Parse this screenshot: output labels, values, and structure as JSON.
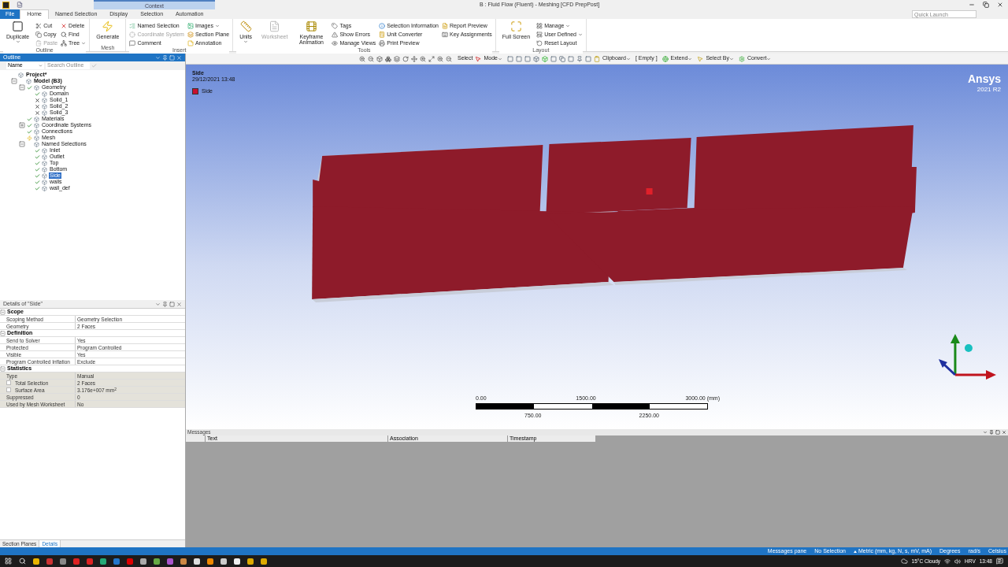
{
  "title_bar": {
    "context_label": "Context",
    "title": "B : Fluid Flow (Fluent) - Meshing [CFD PrepPost]",
    "quick_launch": {
      "placeholder": "Quick Launch"
    }
  },
  "ribbon_tabs": [
    {
      "label": "File",
      "kind": "file",
      "selected": false
    },
    {
      "label": "Home",
      "kind": "tab",
      "selected": true
    },
    {
      "label": "Named Selection",
      "kind": "tab",
      "selected": false
    },
    {
      "label": "Display",
      "kind": "tab",
      "selected": false
    },
    {
      "label": "Selection",
      "kind": "tab",
      "selected": false
    },
    {
      "label": "Automation",
      "kind": "tab",
      "selected": false
    }
  ],
  "ribbon_groups": [
    {
      "label": "Outline",
      "columns": [
        {
          "kind": "large",
          "label": "Duplicate",
          "disabled": false,
          "dropdown": true
        },
        {
          "kind": "stack",
          "items": [
            {
              "label": "Cut",
              "disabled": false,
              "dropdown": false
            },
            {
              "label": "Copy",
              "disabled": false,
              "dropdown": false
            },
            {
              "label": "Paste",
              "disabled": true,
              "dropdown": false
            }
          ]
        },
        {
          "kind": "stack",
          "items": [
            {
              "label": "Delete",
              "disabled": false,
              "dropdown": false
            },
            {
              "label": "Find",
              "disabled": false,
              "dropdown": false
            },
            {
              "label": "Tree",
              "disabled": false,
              "dropdown": true
            }
          ]
        }
      ]
    },
    {
      "label": "Mesh",
      "columns": [
        {
          "kind": "large",
          "label": "Generate",
          "disabled": false,
          "dropdown": false
        }
      ]
    },
    {
      "label": "Insert",
      "columns": [
        {
          "kind": "stack",
          "items": [
            {
              "label": "Named Selection",
              "disabled": false,
              "dropdown": false
            },
            {
              "label": "Coordinate System",
              "disabled": true,
              "dropdown": false
            },
            {
              "label": "Comment",
              "disabled": false,
              "dropdown": false
            }
          ]
        },
        {
          "kind": "stack",
          "items": [
            {
              "label": "Images",
              "disabled": false,
              "dropdown": true
            },
            {
              "label": "Section Plane",
              "disabled": false,
              "dropdown": false
            },
            {
              "label": "Annotation",
              "disabled": false,
              "dropdown": false
            }
          ]
        }
      ]
    },
    {
      "label": "Tools",
      "columns": [
        {
          "kind": "large",
          "label": "Units",
          "disabled": false,
          "dropdown": true
        },
        {
          "kind": "large",
          "label": "Worksheet",
          "disabled": true,
          "dropdown": false
        },
        {
          "kind": "large",
          "label": "Keyframe Animation",
          "disabled": false,
          "dropdown": false
        },
        {
          "kind": "stack",
          "items": [
            {
              "label": "Tags",
              "disabled": false,
              "dropdown": false
            },
            {
              "label": "Show Errors",
              "disabled": false,
              "dropdown": false
            },
            {
              "label": "Manage Views",
              "disabled": false,
              "dropdown": false
            }
          ]
        },
        {
          "kind": "stack",
          "items": [
            {
              "label": "Selection Information",
              "disabled": false,
              "dropdown": false
            },
            {
              "label": "Unit Converter",
              "disabled": false,
              "dropdown": false
            },
            {
              "label": "Print Preview",
              "disabled": false,
              "dropdown": false
            }
          ]
        },
        {
          "kind": "stack",
          "items": [
            {
              "label": "Report Preview",
              "disabled": false,
              "dropdown": false
            },
            {
              "label": "Key Assignments",
              "disabled": false,
              "dropdown": false
            }
          ]
        }
      ]
    },
    {
      "label": "Layout",
      "columns": [
        {
          "kind": "large",
          "label": "Full Screen",
          "disabled": false,
          "dropdown": false
        },
        {
          "kind": "stack",
          "items": [
            {
              "label": "Manage",
              "disabled": false,
              "dropdown": true
            },
            {
              "label": "User Defined",
              "disabled": false,
              "dropdown": true
            },
            {
              "label": "Reset Layout",
              "disabled": false,
              "dropdown": false
            }
          ]
        }
      ]
    }
  ],
  "outline": {
    "title": "Outline",
    "filter": {
      "value": "Name"
    },
    "search": {
      "placeholder": "Search Outline"
    },
    "tree": [
      {
        "label": "Project*",
        "kind": "plain",
        "selected": false,
        "children": [
          {
            "label": "Model (B3)",
            "kind": "plain",
            "expanded": true,
            "selected": false,
            "children": [
              {
                "label": "Geometry",
                "kind": "check",
                "expanded": true,
                "selected": false,
                "children": [
                  {
                    "label": "Domain",
                    "kind": "check",
                    "selected": false
                  },
                  {
                    "label": "Solid_1",
                    "kind": "cross",
                    "selected": false
                  },
                  {
                    "label": "Solid_2",
                    "kind": "cross",
                    "selected": false
                  },
                  {
                    "label": "Solid_3",
                    "kind": "cross",
                    "selected": false
                  }
                ]
              },
              {
                "label": "Materials",
                "kind": "check",
                "selected": false
              },
              {
                "label": "Coordinate Systems",
                "kind": "check",
                "expanded": false,
                "selected": false
              },
              {
                "label": "Connections",
                "kind": "check",
                "selected": false
              },
              {
                "label": "Mesh",
                "kind": "pending",
                "selected": false
              },
              {
                "label": "Named Selections",
                "kind": "plain",
                "expanded": true,
                "selected": false,
                "children": [
                  {
                    "label": "Inlet",
                    "kind": "check",
                    "selected": false
                  },
                  {
                    "label": "Outlet",
                    "kind": "check",
                    "selected": false
                  },
                  {
                    "label": "Top",
                    "kind": "check",
                    "selected": false
                  },
                  {
                    "label": "Bottom",
                    "kind": "check",
                    "selected": false
                  },
                  {
                    "label": "Side",
                    "kind": "check",
                    "selected": true
                  },
                  {
                    "label": "walls",
                    "kind": "check",
                    "selected": false
                  },
                  {
                    "label": "wall_def",
                    "kind": "check",
                    "selected": false
                  }
                ]
              }
            ]
          }
        ]
      }
    ]
  },
  "details": {
    "title": "Details of \"Side\"",
    "sections": [
      {
        "label": "Scope",
        "expanded": true,
        "rows": [
          {
            "label": "Scoping Method",
            "value": "Geometry Selection",
            "readonly": false,
            "indented": false
          },
          {
            "label": "Geometry",
            "value": "2 Faces",
            "readonly": false,
            "indented": false
          }
        ]
      },
      {
        "label": "Definition",
        "expanded": true,
        "rows": [
          {
            "label": "Send to Solver",
            "value": "Yes",
            "readonly": false,
            "indented": false
          },
          {
            "label": "Protected",
            "value": "Program Controlled",
            "readonly": false,
            "indented": false
          },
          {
            "label": "Visible",
            "value": "Yes",
            "readonly": false,
            "indented": false
          },
          {
            "label": "Program Controlled Inflation",
            "value": "Exclude",
            "readonly": false,
            "indented": false
          }
        ]
      },
      {
        "label": "Statistics",
        "expanded": true,
        "rows": [
          {
            "label": "Type",
            "value": "Manual",
            "readonly": true,
            "indented": false
          },
          {
            "label": "Total Selection",
            "value": "2 Faces",
            "readonly": true,
            "indented": true
          },
          {
            "label": "Surface Area",
            "value": "3.176e+007 mm$^{2}$",
            "readonly": true,
            "indented": true
          },
          {
            "label": "Suppressed",
            "value": "0",
            "readonly": true,
            "indented": false
          },
          {
            "label": "Used by Mesh Worksheet",
            "value": "No",
            "readonly": true,
            "indented": false
          }
        ]
      }
    ]
  },
  "bottom_tabs": [
    {
      "label": "Section Planes",
      "selected": false
    },
    {
      "label": "Details",
      "selected": true
    }
  ],
  "toolbar": {
    "select_label": "Select",
    "items": [
      {
        "label": "Mode",
        "dropdown": true
      },
      {
        "label": "Clipboard",
        "dropdown": true
      },
      {
        "label": "[ Empty ]",
        "dropdown": false
      },
      {
        "label": "Extend",
        "dropdown": true
      },
      {
        "label": "Select By",
        "dropdown": true
      },
      {
        "label": "Convert",
        "dropdown": true
      }
    ]
  },
  "viewport": {
    "label": "Side",
    "timestamp": "29/12/2021 13:48",
    "legend": [
      {
        "label": "Side",
        "color": "#c8102e"
      }
    ],
    "brand": "Ansys",
    "version": "2021 R2",
    "scale": {
      "top_labels": [
        "0.00",
        "1500.00",
        "3000.00 (mm)"
      ],
      "bottom_labels": [
        "750.00",
        "2250.00"
      ]
    }
  },
  "messages": {
    "title": "Messages",
    "columns": [
      "Text",
      "Association",
      "Timestamp"
    ]
  },
  "status_bar": {
    "items": [
      "Messages pane",
      "No Selection",
      "Metric (mm, kg, N, s, mV, mA)",
      "Degrees",
      "rad/s",
      "Celsius"
    ]
  },
  "taskbar": {
    "weather": "15°C Cloudy",
    "language": "HRV",
    "time": "13:48"
  }
}
